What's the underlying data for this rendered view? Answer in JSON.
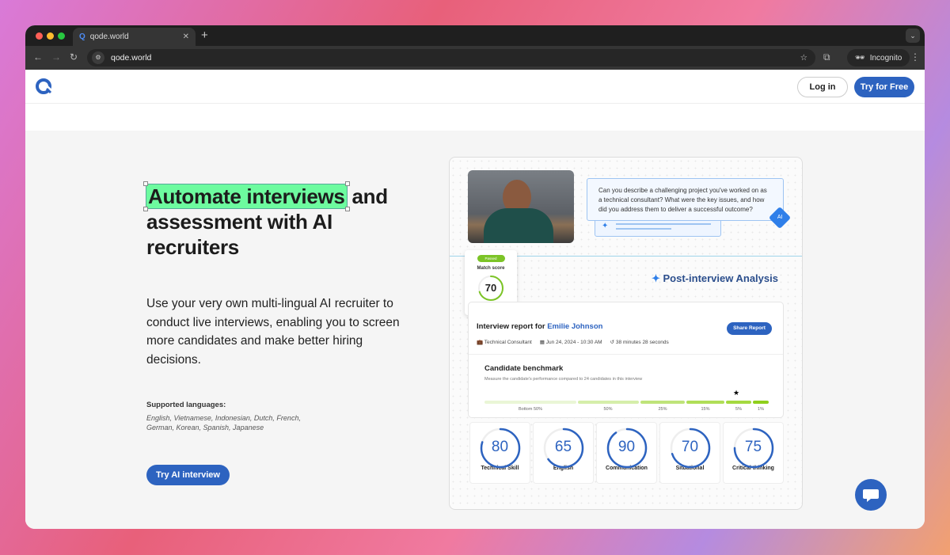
{
  "browser": {
    "tab_title": "qode.world",
    "url": "qode.world",
    "profile": "Incognito"
  },
  "header": {
    "login": "Log in",
    "try_free": "Try for Free"
  },
  "hero": {
    "title_highlight": "Automate interviews",
    "title_rest": " and assessment with AI recruiters",
    "description": "Use your very own multi-lingual AI recruiter to conduct live interviews, enabling you to screen more candidates and make better hiring decisions.",
    "languages_title": "Supported languages:",
    "languages": "English, Vietnamese, Indonesian, Dutch, French, German, Korean, Spanish, Japanese",
    "cta": "Try AI interview"
  },
  "demo": {
    "question": "Can you describe a challenging project you've worked on as a technical consultant? What were the key issues, and how did you address them to deliver a successful outcome?",
    "ai_badge": "AI",
    "match": {
      "status": "Passed",
      "label": "Match score",
      "score": "70",
      "value": 70
    },
    "analysis_title": "Post-interview Analysis",
    "report": {
      "prefix": "Interview report for ",
      "name": "Emilie Johnson",
      "share": "Share Report",
      "role": "Technical Consultant",
      "date": "Jun 24, 2024 - 10:30 AM",
      "duration": "38 minutes 28 seconds"
    },
    "benchmark": {
      "title": "Candidate benchmark",
      "subtitle": "Measure the candidate's performance compared to 24 candidates in this interview",
      "segments": [
        "Bottom 50%",
        "50%",
        "25%",
        "15%",
        "5%",
        "1%"
      ]
    },
    "scores": [
      {
        "label": "Technical Skill",
        "score": "80",
        "value": 80
      },
      {
        "label": "English",
        "score": "65",
        "value": 65
      },
      {
        "label": "Communication",
        "score": "90",
        "value": 90
      },
      {
        "label": "Situational",
        "score": "70",
        "value": 70
      },
      {
        "label": "Critical thinking",
        "score": "75",
        "value": 75
      }
    ]
  },
  "colors": {
    "brand": "#2d63c0",
    "highlight": "#6dfb9f",
    "passed": "#7cc427"
  }
}
